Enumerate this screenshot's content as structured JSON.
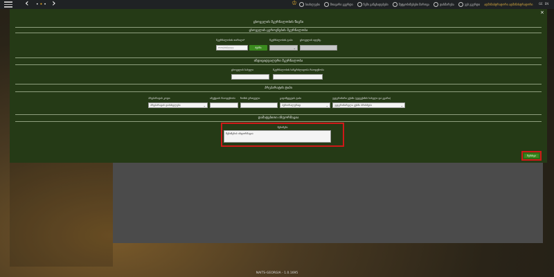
{
  "topbar": {
    "nav_dots": "•",
    "items": [
      {
        "label": "სიახლეები"
      },
      {
        "label": "მთავარი გვერდი"
      },
      {
        "label": "ჩემი განცხადებები"
      },
      {
        "label": "შეტყობინებები მართვა"
      },
      {
        "label": "დახმარება"
      },
      {
        "label": "ვებ გვერდი"
      }
    ],
    "user": "ადმინისტრატორი ადმინისტრატორი",
    "langs": [
      "GE",
      "EN"
    ]
  },
  "modal": {
    "close": "×",
    "title": "ცხოველის მკურნალობის წიგნი",
    "section1": {
      "title": "ცხოველის ცეროვნების მკურნალობა",
      "date_label": "მკურნალობის თარიღი*",
      "date_placeholder": "mm/dd/yyyy",
      "date_button": "ძებნა",
      "status_label": "მკურნალობის ტიპი",
      "animal_label": "ცხოველის იდენტ.",
      "status_value": ""
    },
    "section2": {
      "title": "ინდივიდუალური მკურნალობა",
      "id_label": "ცხოველის სახელი",
      "number_label": "მკურნალობის ხანგრძლივობა რაოდენობა"
    },
    "section3": {
      "title": "პრეპარატის ტიპი",
      "drug_label": "პრეპარატის კოდი",
      "drug_value": "პრეპარატის დასახელება",
      "dose_label": "ინექციის რაოდენობა",
      "unit_label": "ზომის ერთეული",
      "method_label": "გადაწყვეტის ტიპი",
      "method_value": "პერორალურად",
      "doctor_label": "ვეტერინარი ექიმი (ვეტექიმის სახელი და გვარი)",
      "doctor_value": "ვეტერინარული ექიმი ბრძანება"
    },
    "section4": {
      "title": "დამატებითი ინფორმაცია",
      "notes_label": "შენიშვნა",
      "notes_value": "შენიშვნის ინფორმაცია"
    },
    "save": "შენახვა"
  },
  "footer": "NAITS-GEORGIA - 1.0.1695"
}
